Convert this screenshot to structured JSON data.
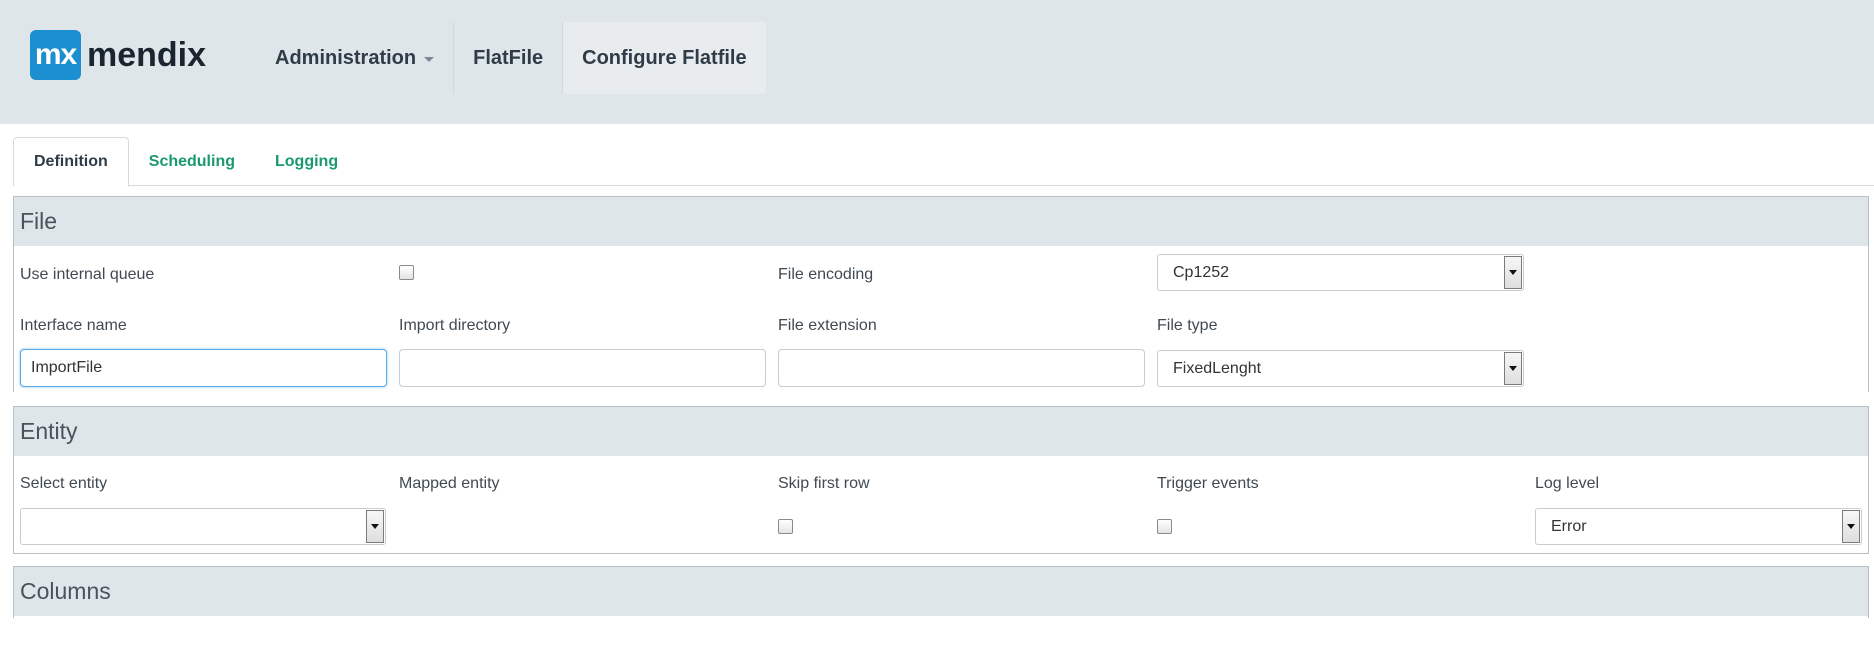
{
  "header": {
    "logo_mark": "mx",
    "logo_text": "mendix",
    "nav": [
      {
        "label": "Administration",
        "has_dropdown": true
      },
      {
        "label": "FlatFile"
      },
      {
        "label": "Configure Flatfile",
        "active": true
      }
    ]
  },
  "tabs": [
    {
      "label": "Definition",
      "active": true
    },
    {
      "label": "Scheduling"
    },
    {
      "label": "Logging"
    }
  ],
  "file": {
    "title": "File",
    "use_internal_queue": {
      "label": "Use internal queue",
      "checked": false
    },
    "file_encoding": {
      "label": "File encoding",
      "value": "Cp1252"
    },
    "interface_name": {
      "label": "Interface name",
      "value": "ImportFile"
    },
    "import_directory": {
      "label": "Import directory",
      "value": ""
    },
    "file_extension": {
      "label": "File extension",
      "value": ""
    },
    "file_type": {
      "label": "File type",
      "value": "FixedLenght"
    }
  },
  "entity": {
    "title": "Entity",
    "select_entity": {
      "label": "Select entity",
      "value": ""
    },
    "mapped_entity": {
      "label": "Mapped entity"
    },
    "skip_first_row": {
      "label": "Skip first row",
      "checked": false
    },
    "trigger_events": {
      "label": "Trigger events",
      "checked": false
    },
    "log_level": {
      "label": "Log level",
      "value": "Error"
    }
  },
  "columns": {
    "title": "Columns"
  },
  "colors": {
    "header_bg": "#dfe6ea",
    "tab_link": "#1a9a6c",
    "logo_blue": "#1c8fd0"
  }
}
